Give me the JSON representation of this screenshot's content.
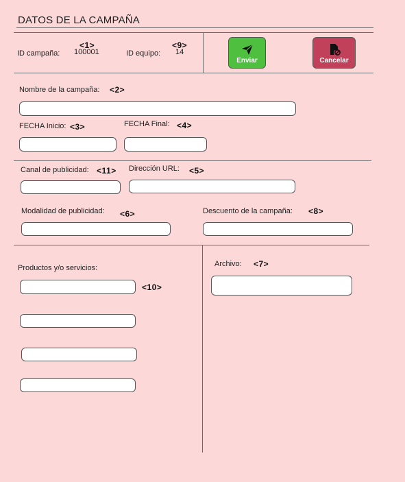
{
  "title": "DATOS DE LA CAMPAÑA",
  "header": {
    "id_campana_label": "ID campaña:",
    "id_campana_value": "100001",
    "id_equipo_label": "ID equipo:",
    "id_equipo_value": "14",
    "marker_1": "<1>",
    "marker_9": "<9>"
  },
  "buttons": {
    "send_label": "Enviar",
    "cancel_label": "Cancelar",
    "send_color": "#4fbf3f",
    "cancel_color": "#c1405a"
  },
  "form": {
    "nombre_label": "Nombre de la campaña:",
    "marker_2": "<2>",
    "fecha_inicio_label": "FECHA Inicio:",
    "marker_3": "<3>",
    "fecha_final_label": "FECHA Final:",
    "marker_4": "<4>",
    "canal_label": "Canal de publicidad:",
    "marker_11": "<11>",
    "url_label": "Dirección URL:",
    "marker_5": "<5>",
    "modalidad_label": "Modalidad de publicidad:",
    "marker_6": "<6>",
    "descuento_label": "Descuento de la campaña:",
    "marker_8": "<8>",
    "productos_label": "Productos y/o servicios:",
    "marker_10": "<10>",
    "archivo_label": "Archivo:",
    "marker_7": "<7>"
  }
}
